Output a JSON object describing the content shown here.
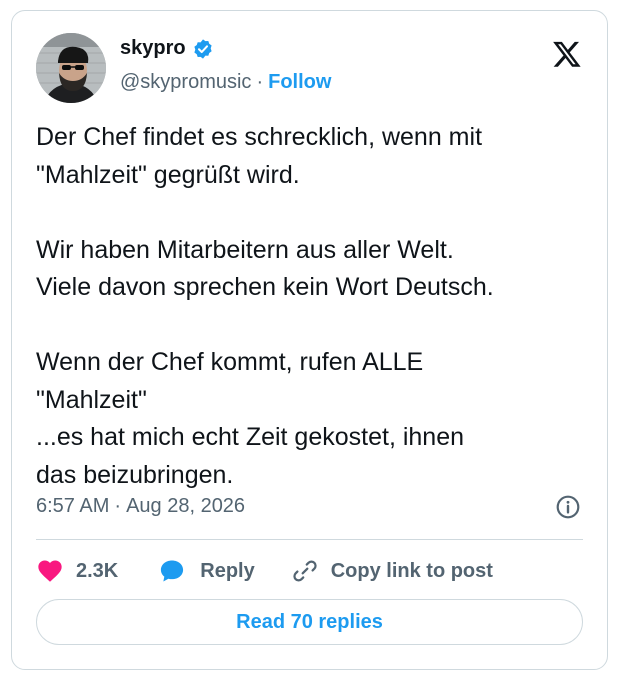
{
  "author": {
    "name": "skypro",
    "handle": "@skypromusic",
    "separator": "·",
    "follow_label": "Follow"
  },
  "icons": {
    "platform": "x-logo-icon",
    "verified": "verified-badge-icon",
    "info": "info-icon",
    "like": "heart-icon",
    "reply": "speech-bubble-icon",
    "copy": "link-icon"
  },
  "tweet": {
    "text": "Der Chef findet es schrecklich, wenn mit\n\"Mahlzeit\" gegrüßt wird.\n\nWir haben Mitarbeitern aus aller Welt.\nViele davon sprechen kein Wort Deutsch.\n\nWenn der Chef kommt, rufen ALLE\n\"Mahlzeit\"\n...es hat mich echt Zeit gekostet, ihnen\ndas beizubringen.",
    "time": "6:57 AM",
    "separator": "·",
    "date": "Aug 28, 2026"
  },
  "actions": {
    "likes": "2.3K",
    "reply_label": "Reply",
    "copy_label": "Copy link to post",
    "read_replies_label": "Read 70 replies"
  },
  "colors": {
    "accent": "#1d9bf0",
    "like": "#f91880",
    "text": "#0f1419",
    "muted": "#536471",
    "border": "#cfd9de"
  }
}
